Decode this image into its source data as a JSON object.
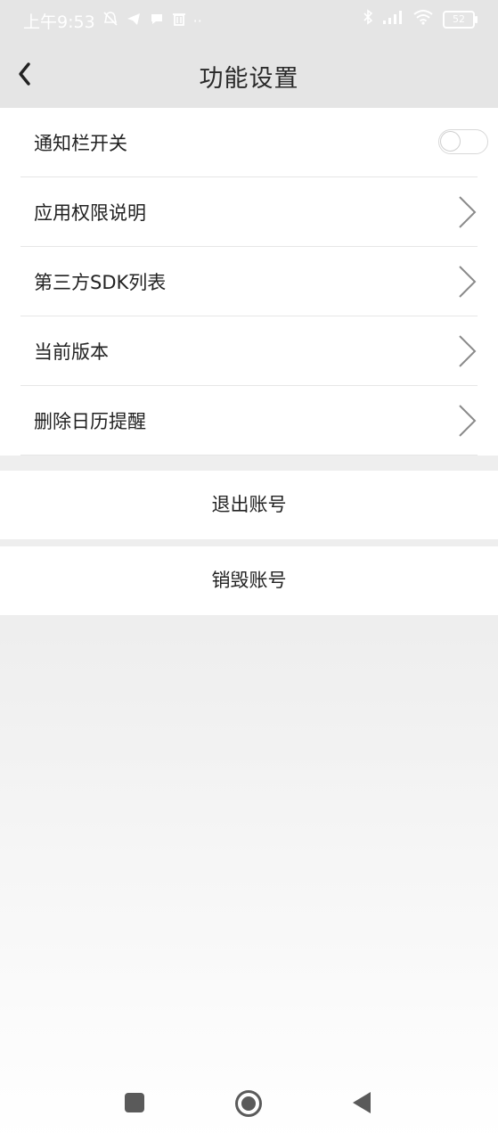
{
  "status_bar": {
    "time": "上午9:53",
    "dots": "··",
    "battery": "52",
    "icons": [
      "mute-icon",
      "telegram-icon",
      "chat-icon",
      "trash-icon",
      "bluetooth-icon",
      "signal-icon",
      "wifi-icon",
      "battery-icon"
    ]
  },
  "header": {
    "title": "功能设置",
    "back_icon": "chevron-left-icon"
  },
  "menu": {
    "items": [
      {
        "label": "通知栏开关",
        "control": "toggle",
        "toggle_on": false
      },
      {
        "label": "应用权限说明",
        "control": "chevron"
      },
      {
        "label": "第三方SDK列表",
        "control": "chevron"
      },
      {
        "label": "当前版本",
        "control": "chevron"
      },
      {
        "label": "删除日历提醒",
        "control": "chevron"
      }
    ]
  },
  "actions": {
    "logout_label": "退出账号",
    "delete_account_label": "销毁账号"
  },
  "nav_bar": {
    "icons": [
      "recent-apps-icon",
      "home-icon",
      "back-triangle-icon"
    ]
  }
}
